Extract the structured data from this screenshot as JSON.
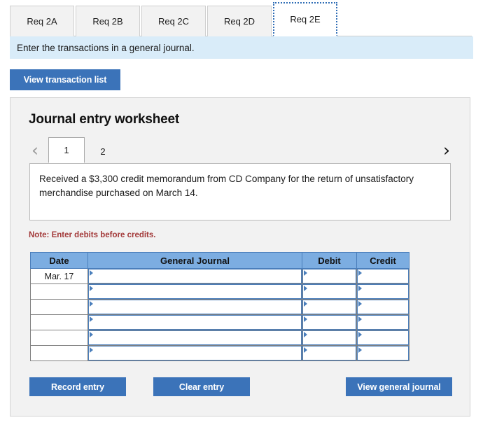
{
  "requirement_tabs": [
    {
      "label": "Req 2A",
      "active": false
    },
    {
      "label": "Req 2B",
      "active": false
    },
    {
      "label": "Req 2C",
      "active": false
    },
    {
      "label": "Req 2D",
      "active": false
    },
    {
      "label": "Req 2E",
      "active": true
    }
  ],
  "instruction": {
    "text": "Enter the transactions in a general journal."
  },
  "toolbar": {
    "view_transaction_list_label": "View transaction list"
  },
  "worksheet": {
    "title": "Journal entry worksheet",
    "pager": {
      "prev_icon": "chevron-left",
      "prev_glyph": "‹",
      "next_icon": "chevron-right",
      "next_glyph": "›",
      "pages": [
        {
          "label": "1",
          "active": true
        },
        {
          "label": "2",
          "active": false
        }
      ]
    },
    "entry_description": "Received a $3,300 credit memorandum from CD Company for the return of unsatisfactory merchandise purchased on March 14.",
    "note": "Note: Enter debits before credits.",
    "table": {
      "headers": [
        "Date",
        "General Journal",
        "Debit",
        "Credit"
      ],
      "rows": [
        {
          "date": "Mar. 17",
          "general_journal": "",
          "debit": "",
          "credit": ""
        },
        {
          "date": "",
          "general_journal": "",
          "debit": "",
          "credit": ""
        },
        {
          "date": "",
          "general_journal": "",
          "debit": "",
          "credit": ""
        },
        {
          "date": "",
          "general_journal": "",
          "debit": "",
          "credit": ""
        },
        {
          "date": "",
          "general_journal": "",
          "debit": "",
          "credit": ""
        },
        {
          "date": "",
          "general_journal": "",
          "debit": "",
          "credit": ""
        }
      ]
    },
    "actions": {
      "record_entry_label": "Record entry",
      "clear_entry_label": "Clear entry",
      "view_general_journal_label": "View general journal"
    }
  },
  "colors": {
    "primary_button": "#3b73b9",
    "banner_background": "#d9ecf9",
    "table_header": "#7cade1",
    "table_cell_border": "#4a7ebb",
    "note_text": "#a33a3a",
    "panel_background": "#f2f2f2",
    "active_tab_focus": "#2f6db5"
  }
}
